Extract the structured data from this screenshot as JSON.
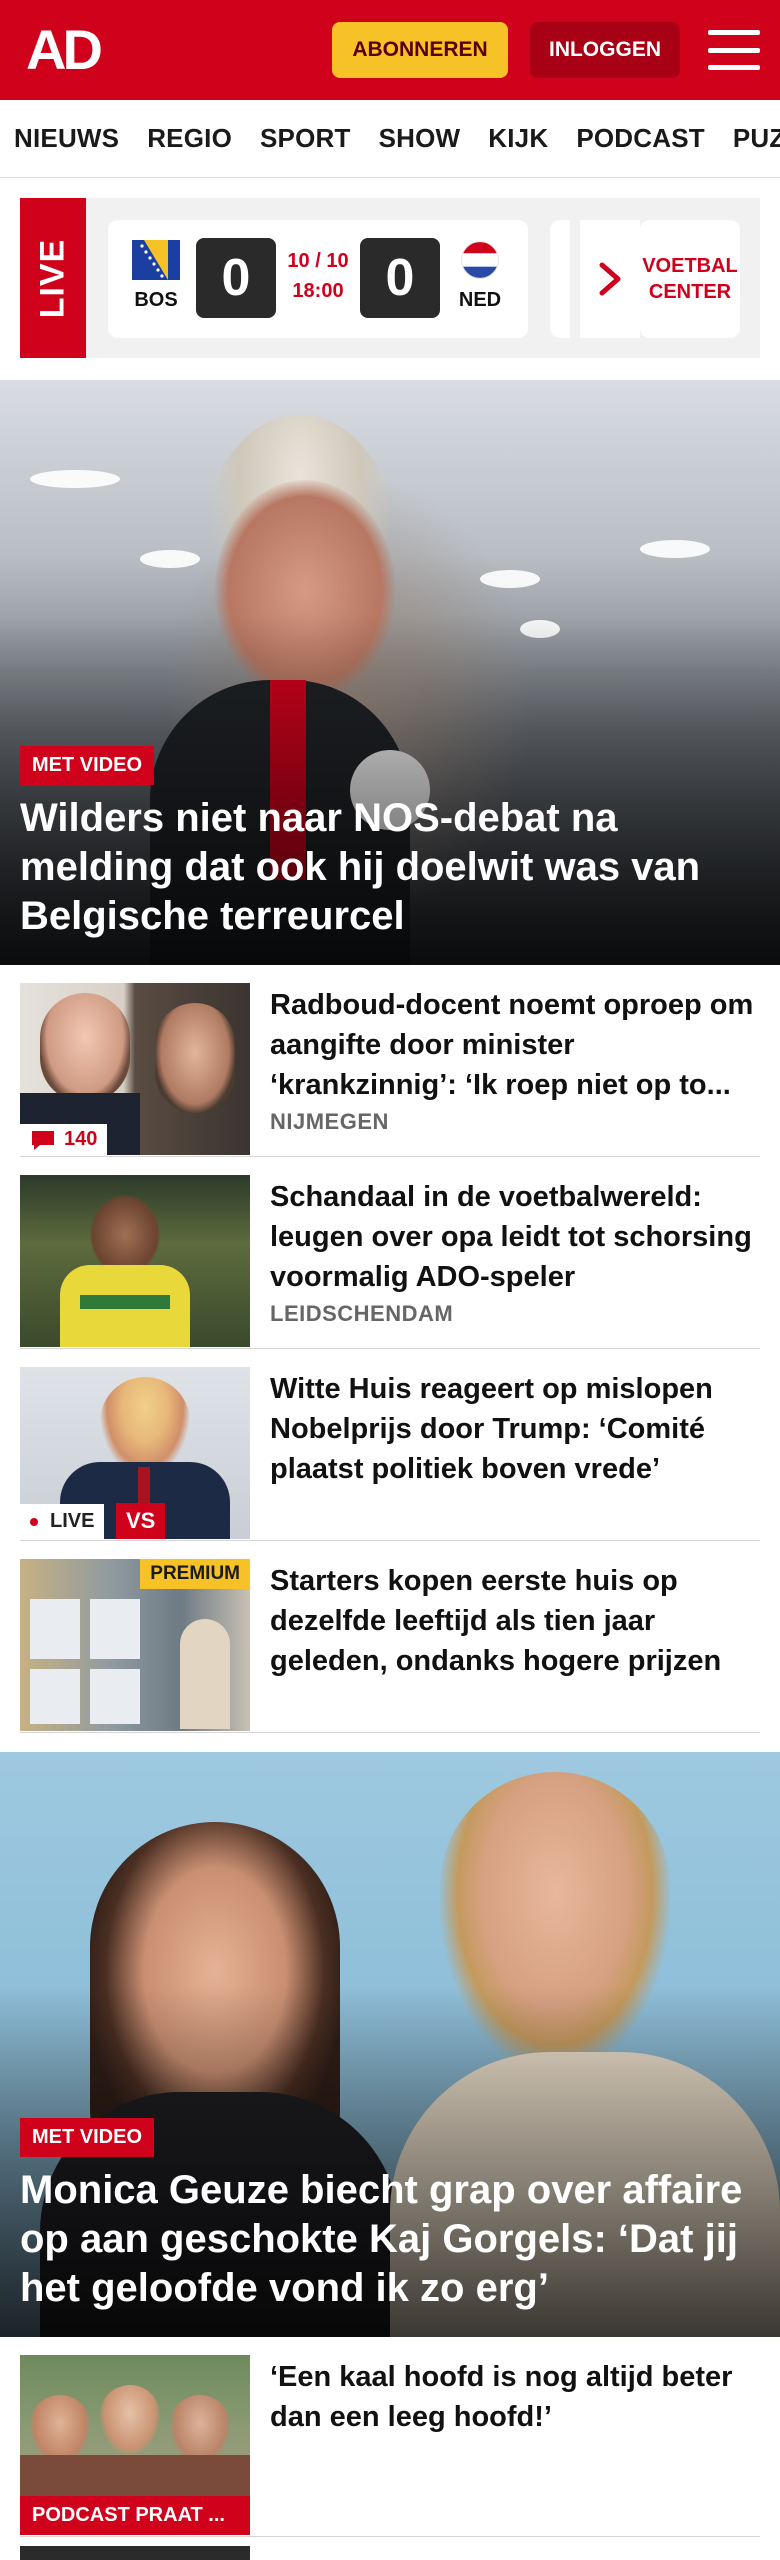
{
  "header": {
    "logo_text": "AD",
    "subscribe_label": "ABONNEREN",
    "login_label": "INLOGGEN",
    "brand_color": "#d0021b",
    "menu_icon": "hamburger-icon"
  },
  "nav": {
    "items": [
      "NIEUWS",
      "REGIO",
      "SPORT",
      "SHOW",
      "KIJK",
      "PODCAST",
      "PUZZ"
    ]
  },
  "livebar": {
    "live_label": "LIVE",
    "match": {
      "home_code": "BOS",
      "away_code": "NED",
      "home_score": "0",
      "away_score": "0",
      "date": "10 / 10",
      "time": "18:00"
    },
    "center_label_1": "VOETBAL",
    "center_label_2": "CENTER"
  },
  "hero1": {
    "badge": "MET VIDEO",
    "title": "Wilders niet naar NOS-debat na melding dat ook hij doelwit was van Belgische terreurcel"
  },
  "articles": [
    {
      "title": "Radboud-docent noemt oproep om aangifte door minister ‘krankzinnig’: ‘Ik roep niet op to...",
      "location": "NIJMEGEN",
      "comments": "140"
    },
    {
      "title": "Schandaal in de voetbalwereld: leugen over opa leidt tot schorsing voormalig ADO-speler",
      "location": "LEIDSCHENDAM"
    },
    {
      "title": "Witte Huis reageert op mislopen Nobelprijs door Trump: ‘Comité plaatst politiek boven vrede’",
      "live_label": "LIVE",
      "vs_label": "VS"
    },
    {
      "title": "Starters kopen eerste huis op dezelfde leeftijd als tien jaar geleden, ondanks hogere prijzen",
      "premium_label": "PREMIUM"
    }
  ],
  "hero2": {
    "badge": "MET VIDEO",
    "title": "Monica Geuze biecht grap over affaire op aan geschokte Kaj Gorgels: ‘Dat jij het geloofde vond ik zo erg’"
  },
  "article5": {
    "title": "‘Een kaal hoofd is nog altijd beter dan een leeg hoofd!’",
    "badge": "PODCAST PRAAT ..."
  }
}
